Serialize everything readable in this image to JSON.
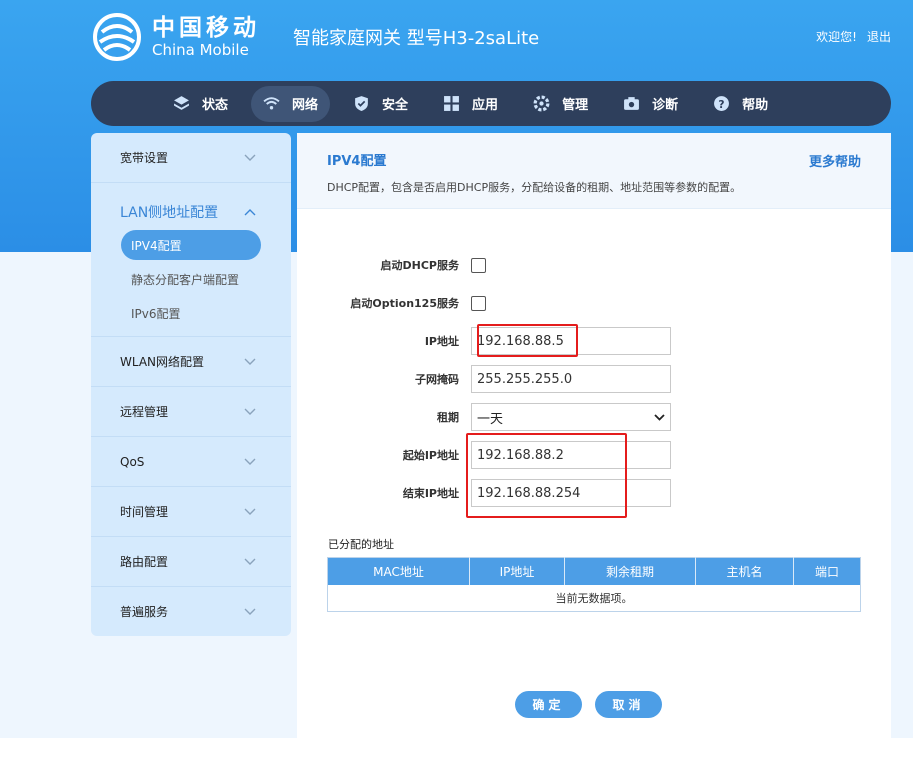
{
  "header": {
    "logo_cn": "中国移动",
    "logo_en": "China Mobile",
    "device_title": "智能家庭网关 型号H3-2saLite",
    "welcome": "欢迎您!",
    "logout": "退出"
  },
  "nav": {
    "items": [
      {
        "label": "状态",
        "icon": "layers-icon"
      },
      {
        "label": "网络",
        "icon": "wifi-icon",
        "active": true
      },
      {
        "label": "安全",
        "icon": "shield-icon"
      },
      {
        "label": "应用",
        "icon": "grid-icon"
      },
      {
        "label": "管理",
        "icon": "gear-icon"
      },
      {
        "label": "诊断",
        "icon": "camera-icon"
      },
      {
        "label": "帮助",
        "icon": "help-icon"
      }
    ]
  },
  "sidebar": {
    "groups": [
      {
        "label": "宽带设置"
      },
      {
        "label": "LAN侧地址配置",
        "open": true,
        "subitems": [
          "IPV4配置",
          "静态分配客户端配置",
          "IPv6配置"
        ]
      },
      {
        "label": "WLAN网络配置"
      },
      {
        "label": "远程管理"
      },
      {
        "label": "QoS"
      },
      {
        "label": "时间管理"
      },
      {
        "label": "路由配置"
      },
      {
        "label": "普遍服务"
      }
    ]
  },
  "panel": {
    "title": "IPV4配置",
    "description": "DHCP配置，包含是否启用DHCP服务，分配给设备的租期、地址范围等参数的配置。",
    "more_help": "更多帮助"
  },
  "form": {
    "dhcp_label": "启动DHCP服务",
    "option125_label": "启动Option125服务",
    "ip_label": "IP地址",
    "ip_value": "192.168.88.5",
    "mask_label": "子网掩码",
    "mask_value": "255.255.255.0",
    "lease_label": "租期",
    "lease_value": "一天",
    "start_ip_label": "起始IP地址",
    "start_ip_value": "192.168.88.2",
    "end_ip_label": "结束IP地址",
    "end_ip_value": "192.168.88.254"
  },
  "assigned": {
    "title": "已分配的地址",
    "columns": [
      "MAC地址",
      "IP地址",
      "剩余租期",
      "主机名",
      "端口"
    ],
    "empty_text": "当前无数据项。"
  },
  "buttons": {
    "confirm": "确定",
    "cancel": "取消"
  },
  "colors": {
    "brand_blue": "#2b8ee6",
    "nav_bg": "#2e3f5c",
    "accent": "#4d9ee6",
    "highlight_red": "#e41c1c"
  }
}
